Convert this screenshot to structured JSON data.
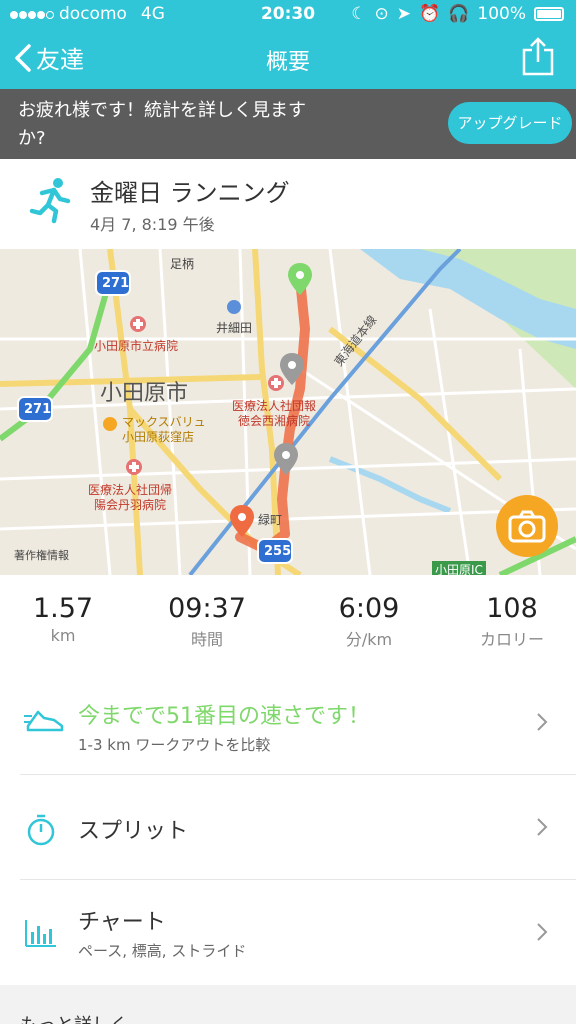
{
  "status_bar": {
    "carrier": "docomo",
    "network": "4G",
    "time": "20:30",
    "battery": "100%"
  },
  "nav": {
    "back_label": "友達",
    "title": "概要"
  },
  "banner": {
    "message": "お疲れ様です！統計を詳しく見ますか?",
    "upgrade_label": "アップグレード"
  },
  "activity": {
    "title": "金曜日 ランニング",
    "date": "4月 7, 8:19 午後"
  },
  "map": {
    "labels": {
      "route271a": "271",
      "route271b": "271",
      "route255": "255",
      "ashigara": "足柄",
      "ihosoda": "井細田",
      "hospital1": "小田原市立病院",
      "city": "小田原市",
      "hospital2a": "医療法人社団報",
      "hospital2b": "徳会西湘病院",
      "maxvalu1": "マックスバリュ",
      "maxvalu2": "小田原荻窪店",
      "hospital3a": "医療法人社団帰",
      "hospital3b": "陽会丹羽病院",
      "line": "東海道本線",
      "station": "緑町",
      "ic": "小田原IC",
      "credit": "著作権情報"
    }
  },
  "stats": [
    {
      "value": "1.57",
      "unit": "km"
    },
    {
      "value": "09:37",
      "unit": "時間"
    },
    {
      "value": "6:09",
      "unit": "分/km"
    },
    {
      "value": "108",
      "unit": "カロリー"
    }
  ],
  "rows": {
    "compare": {
      "main": "今までで51番目の速さです！",
      "sub": "1-3 km ワークアウトを比較"
    },
    "splits": {
      "main": "スプリット"
    },
    "chart": {
      "main": "チャート",
      "sub": "ペース, 標高, ストライド"
    }
  },
  "more_label": "もっと詳しく",
  "colors": {
    "accent": "#30c6d8",
    "banner": "#5c5c5c",
    "route": "#ef6c43",
    "highlight": "#7fd86b",
    "camera": "#f5a623"
  }
}
